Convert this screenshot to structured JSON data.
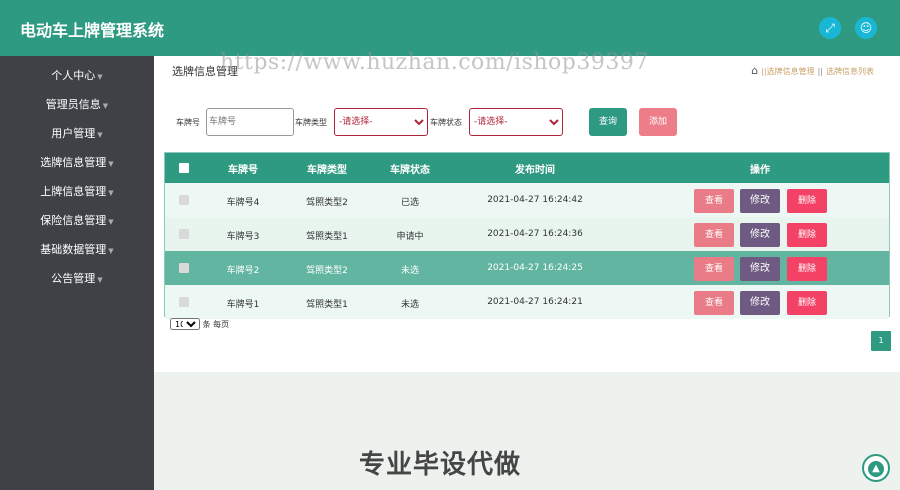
{
  "app": {
    "title": "电动车上牌管理系统",
    "colors": {
      "primary": "#2f9a82",
      "sidebar": "#3f4146",
      "accent_cyan": "#19b7d6"
    }
  },
  "topbar": {
    "fullscreen_icon": "expand-icon",
    "user_icon": "user-icon"
  },
  "sidebar": {
    "items": [
      {
        "label": "个人中心"
      },
      {
        "label": "管理员信息"
      },
      {
        "label": "用户管理"
      },
      {
        "label": "选牌信息管理"
      },
      {
        "label": "上牌信息管理"
      },
      {
        "label": "保险信息管理"
      },
      {
        "label": "基础数据管理"
      },
      {
        "label": "公告管理"
      }
    ]
  },
  "page": {
    "title": "选牌信息管理",
    "watermark": "https://www.huzhan.com/ishop39397",
    "bottom_text": "专业毕设代做"
  },
  "breadcrumb": {
    "items": [
      "选牌信息管理",
      "选牌信息列表"
    ],
    "separator": "||"
  },
  "filters": {
    "plate_label": "车牌号",
    "plate_placeholder": "车牌号",
    "type_label": "车牌类型",
    "type_value": "-请选择-",
    "status_label": "车牌状态",
    "status_value": "-请选择-",
    "query_label": "查询",
    "add_label": "添加"
  },
  "table": {
    "headers": [
      "车牌号",
      "车牌类型",
      "车牌状态",
      "发布时间",
      "操作"
    ],
    "rows": [
      {
        "plate": "车牌号4",
        "type": "驾照类型2",
        "status": "已选",
        "time": "2021-04-27 16:24:42"
      },
      {
        "plate": "车牌号3",
        "type": "驾照类型1",
        "status": "申请中",
        "time": "2021-04-27 16:24:36"
      },
      {
        "plate": "车牌号2",
        "type": "驾照类型2",
        "status": "未选",
        "time": "2021-04-27 16:24:25"
      },
      {
        "plate": "车牌号1",
        "type": "驾照类型1",
        "status": "未选",
        "time": "2021-04-27 16:24:21"
      }
    ],
    "actions": {
      "view": "查看",
      "edit": "修改",
      "delete": "删除"
    }
  },
  "pagination": {
    "page_size": "10",
    "page_size_suffix": "条 每页",
    "current_page": "1"
  }
}
